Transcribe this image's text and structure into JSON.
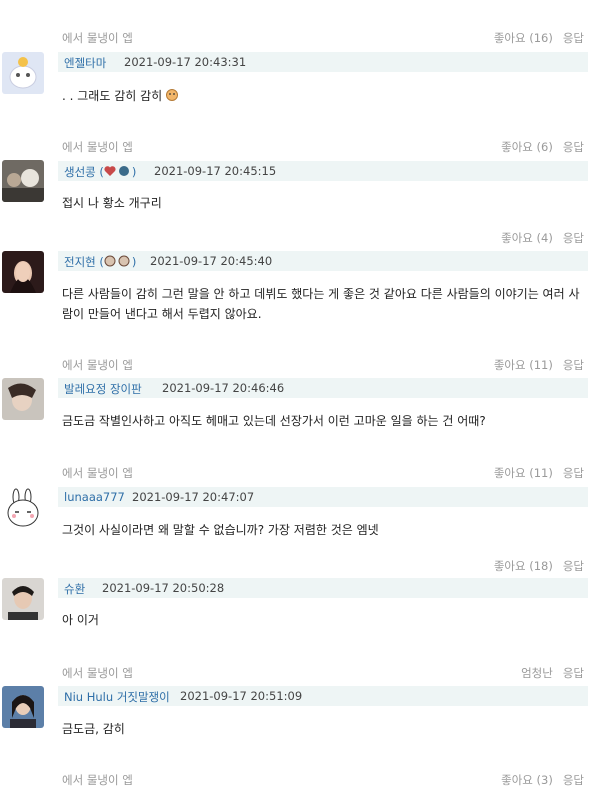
{
  "comments": [
    {
      "source": "에서 물냉이 엡",
      "likes": "좋아요 (16)",
      "reply": "응답",
      "name": "엔젤타마",
      "time": "2021-09-17 20:43:31",
      "text": ". . 그래도 감히 감히"
    },
    {
      "source": "에서 물냉이 엡",
      "likes": "좋아요 (6)",
      "reply": "응답",
      "name": "생선콩 (",
      "name_suffix": ")",
      "time": "2021-09-17 20:45:15",
      "text": "접시 나 황소 개구리"
    },
    {
      "likes": "좋아요 (4)",
      "reply": "응답",
      "name": "전지현 (",
      "name_suffix": ")",
      "time": "2021-09-17 20:45:40",
      "text": "다른 사람들이 감히 그런 말을 안 하고 데뷔도 했다는 게 좋은 것 같아요 다른 사람들의 이야기는 여러 사람이 만들어 낸다고 해서 두렵지 않아요."
    },
    {
      "source": "에서 물냉이 엡",
      "likes": "좋아요 (11)",
      "reply": "응답",
      "name": "발레요정 장이판",
      "time": "2021-09-17 20:46:46",
      "text": "금도금 작별인사하고 아직도 헤매고 있는데 선장가서 이런 고마운 일을 하는 건 어때?"
    },
    {
      "source": "에서 물냉이 엡",
      "likes": "좋아요 (11)",
      "reply": "응답",
      "name": "lunaaa777",
      "time": "2021-09-17 20:47:07",
      "text": "그것이 사실이라면 왜 말할 수 없습니까? 가장 저렴한 것은 엠넷"
    },
    {
      "likes": "좋아요 (18)",
      "reply": "응답",
      "name": "슈환",
      "time": "2021-09-17 20:50:28",
      "text": "아 이거"
    },
    {
      "source": "에서 물냉이 엡",
      "likes": "엄청난",
      "reply": "응답",
      "name": "Niu Hulu 거짓말쟁이",
      "time": "2021-09-17 20:51:09",
      "text": "금도금, 감히"
    },
    {
      "source": "에서 물냉이 엡",
      "likes": "좋아요 (3)",
      "reply": "응답"
    }
  ],
  "colors": {
    "name": "#2f6fa8",
    "bar": "#eef5f5",
    "meta": "#9a9a9a"
  }
}
